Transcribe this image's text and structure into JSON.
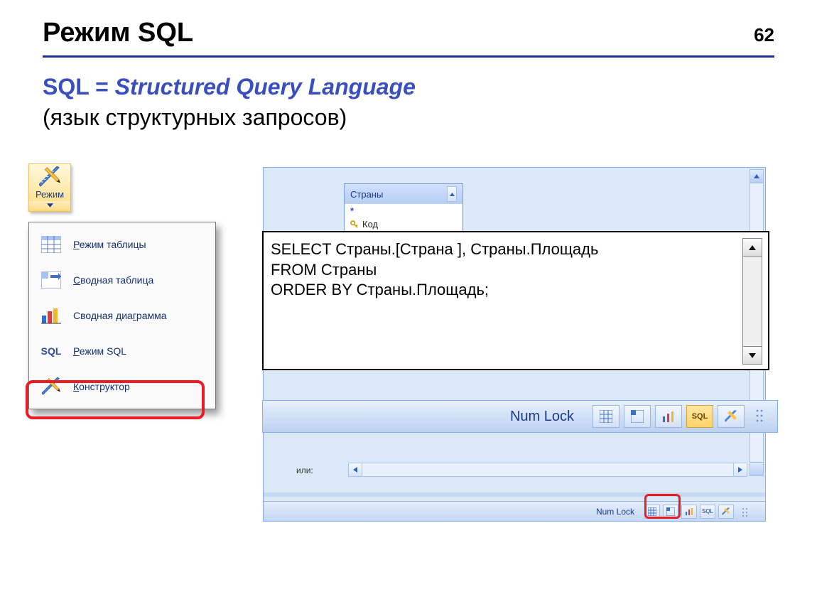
{
  "page": {
    "title": "Режим SQL",
    "number": "62"
  },
  "subtitle": {
    "prefix": "SQL = ",
    "expansion": "Structured Query Language",
    "translation": "(язык структурных запросов)"
  },
  "mode_button": {
    "label": "Режим"
  },
  "dropdown": {
    "items": [
      {
        "label_prefix": "Р",
        "label_rest": "ежим таблицы",
        "icon": "table"
      },
      {
        "label_prefix": "С",
        "label_rest": "водная таблица",
        "icon": "pivot"
      },
      {
        "label_prefix": "",
        "label_rest": "Сводная диа",
        "label_u": "г",
        "label_tail": "рамма",
        "icon": "chart"
      },
      {
        "label_prefix": "Р",
        "label_rest": "ежим SQL",
        "icon": "sql",
        "icon_text": "SQL"
      },
      {
        "label_prefix": "К",
        "label_rest": "онструктор",
        "icon": "ruler"
      }
    ]
  },
  "table_chip": {
    "title": "Страны",
    "star": "*",
    "key_field": "Код"
  },
  "sql": {
    "l1": "SELECT Страны.[Страна ], Страны.Площадь",
    "l2": "FROM Страны",
    "l3": "ORDER BY Страны.Площадь;"
  },
  "bigstatus": {
    "numlock": "Num Lock",
    "sql_btn": "SQL"
  },
  "smallstatus": {
    "numlock": "Num Lock",
    "sql_btn": "SQL"
  },
  "panel": {
    "or_label": "или:"
  }
}
